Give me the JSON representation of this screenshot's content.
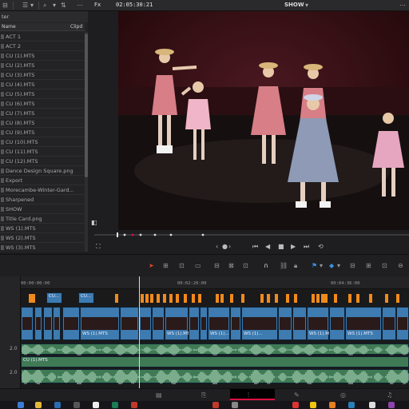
{
  "toolbar": {
    "fx_label": "Fx",
    "timecode": "02:05:30:21",
    "timeline_name": "SHOW",
    "icons": [
      "list-view-icon",
      "search-icon",
      "more-icon",
      "fx-icon"
    ]
  },
  "media_pool": {
    "header_suffix": "ter",
    "columns": {
      "name": "Name",
      "clip": "Clipd"
    },
    "items": [
      {
        "label": "ACT 1",
        "icon": "bin-icon"
      },
      {
        "label": "ACT 2",
        "icon": "bin-icon"
      },
      {
        "label": "CU (1).MTS",
        "icon": "clip-icon"
      },
      {
        "label": "CU (2).MTS",
        "icon": "clip-icon"
      },
      {
        "label": "CU (3).MTS",
        "icon": "clip-icon"
      },
      {
        "label": "CU (4).MTS",
        "icon": "clip-icon"
      },
      {
        "label": "CU (5).MTS",
        "icon": "clip-icon"
      },
      {
        "label": "CU (6).MTS",
        "icon": "clip-icon"
      },
      {
        "label": "CU (7).MTS",
        "icon": "clip-icon"
      },
      {
        "label": "CU (8).MTS",
        "icon": "clip-icon"
      },
      {
        "label": "CU (9).MTS",
        "icon": "clip-icon"
      },
      {
        "label": "CU (10).MTS",
        "icon": "clip-icon"
      },
      {
        "label": "CU (11).MTS",
        "icon": "clip-icon"
      },
      {
        "label": "CU (12).MTS",
        "icon": "clip-icon"
      },
      {
        "label": "Dance Design Square.png",
        "icon": "image-icon"
      },
      {
        "label": "Export",
        "icon": "bin-icon"
      },
      {
        "label": "Morecambe-Winter-Gard...",
        "icon": "image-icon"
      },
      {
        "label": "Sharpened",
        "icon": "bin-icon"
      },
      {
        "label": "SHOW",
        "icon": "timeline-icon"
      },
      {
        "label": "Title Card.png",
        "icon": "image-icon"
      },
      {
        "label": "WS (1).MTS",
        "icon": "clip-icon"
      },
      {
        "label": "WS (2).MTS",
        "icon": "clip-icon"
      },
      {
        "label": "WS (3).MTS",
        "icon": "clip-icon"
      }
    ]
  },
  "timeline": {
    "ruler_marks": [
      "00:00:00:00",
      "00:02:20:00",
      "00:04:36:00"
    ],
    "audio_track_levels": [
      "2.0",
      "2.0"
    ],
    "video_clip_labels": [
      "CU...",
      "CU...",
      "WS (1).MTS",
      "WS (1).MTS",
      "WS (1)...",
      "WS (1)...",
      "WS (1).MTS"
    ],
    "audio_clip_label": "CU (1).MTS"
  },
  "colors": {
    "accent": "#d9402b",
    "video_clip": "#3d7bb0",
    "audio_clip": "#3f7a55",
    "marker": "#f08a1c"
  },
  "pages": [
    "media-page-icon",
    "cut-page-icon",
    "edit-page-icon",
    "fusion-page-icon",
    "color-page-icon",
    "fairlight-page-icon"
  ]
}
